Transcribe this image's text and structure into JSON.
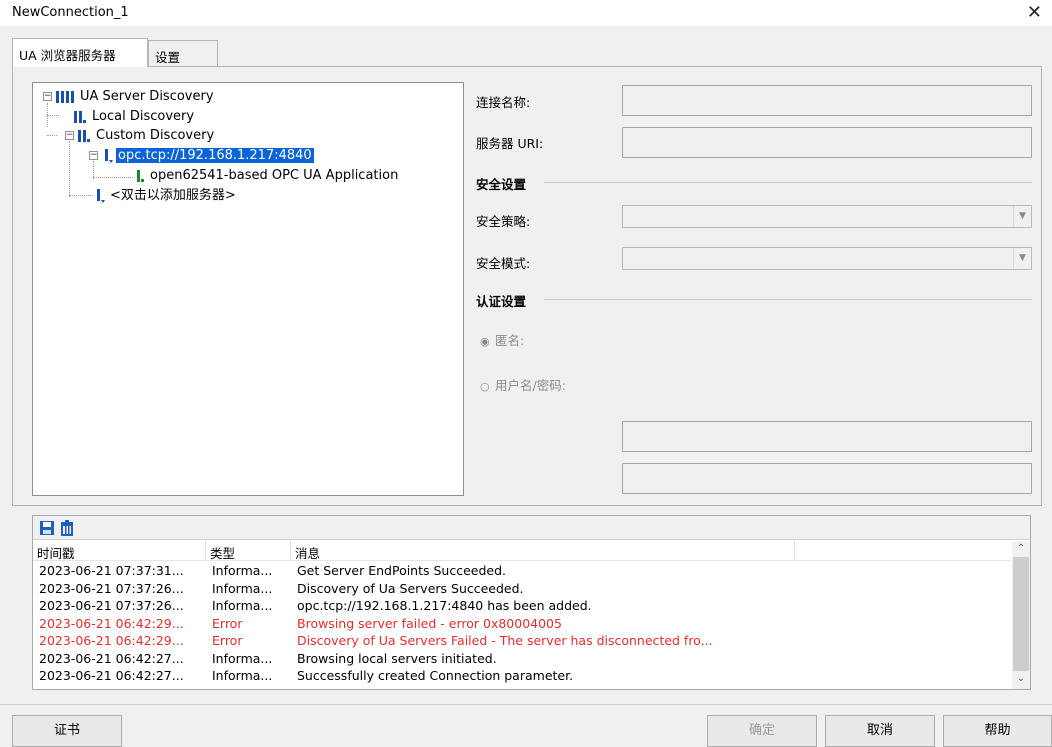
{
  "window": {
    "title": "NewConnection_1",
    "close_symbol": "✕"
  },
  "tabs": [
    {
      "label": "UA 浏览器服务器"
    },
    {
      "label": "设置"
    }
  ],
  "tree": {
    "root": "UA Server Discovery",
    "local": "Local Discovery",
    "custom": "Custom Discovery",
    "server": "opc.tcp://192.168.1.217:4840",
    "application": "open62541-based OPC UA Application",
    "add_server": "<双击以添加服务器>"
  },
  "form": {
    "connection_name_label": "连接名称:",
    "connection_name_value": "",
    "server_uri_label": "服务器 URI:",
    "server_uri_value": "",
    "security_group": "安全设置",
    "security_policy_label": "安全策略:",
    "security_policy_value": "",
    "security_mode_label": "安全模式:",
    "security_mode_value": "",
    "auth_group": "认证设置",
    "anonymous_label": "匿名:",
    "userpass_label": "用户名/密码:",
    "username_value": "",
    "password_value": ""
  },
  "log": {
    "columns": [
      "时间戳",
      "类型",
      "消息",
      ""
    ],
    "rows": [
      {
        "time": "2023-06-21 07:37:31...",
        "type": "Informa...",
        "message": "Get Server EndPoints Succeeded.",
        "level": "info"
      },
      {
        "time": "2023-06-21 07:37:26...",
        "type": "Informa...",
        "message": "Discovery of Ua Servers Succeeded.",
        "level": "info"
      },
      {
        "time": "2023-06-21 07:37:26...",
        "type": "Informa...",
        "message": "opc.tcp://192.168.1.217:4840 has been added.",
        "level": "info"
      },
      {
        "time": "2023-06-21 06:42:29...",
        "type": "Error",
        "message": "Browsing server failed - error 0x80004005",
        "level": "error"
      },
      {
        "time": "2023-06-21 06:42:29...",
        "type": "Error",
        "message": "Discovery of Ua Servers Failed - The server has disconnected fro...",
        "level": "error"
      },
      {
        "time": "2023-06-21 06:42:27...",
        "type": "Informa...",
        "message": "Browsing local servers initiated.",
        "level": "info"
      },
      {
        "time": "2023-06-21 06:42:27...",
        "type": "Informa...",
        "message": "Successfully created Connection parameter.",
        "level": "info"
      }
    ]
  },
  "buttons": {
    "certificate": "证书",
    "ok": "确定",
    "cancel": "取消",
    "help": "帮助"
  },
  "colors": {
    "selection": "#0a64d8",
    "error_text": "#e03030",
    "server_icon": "#1a4fb0",
    "app_icon": "#1d8a2a"
  }
}
